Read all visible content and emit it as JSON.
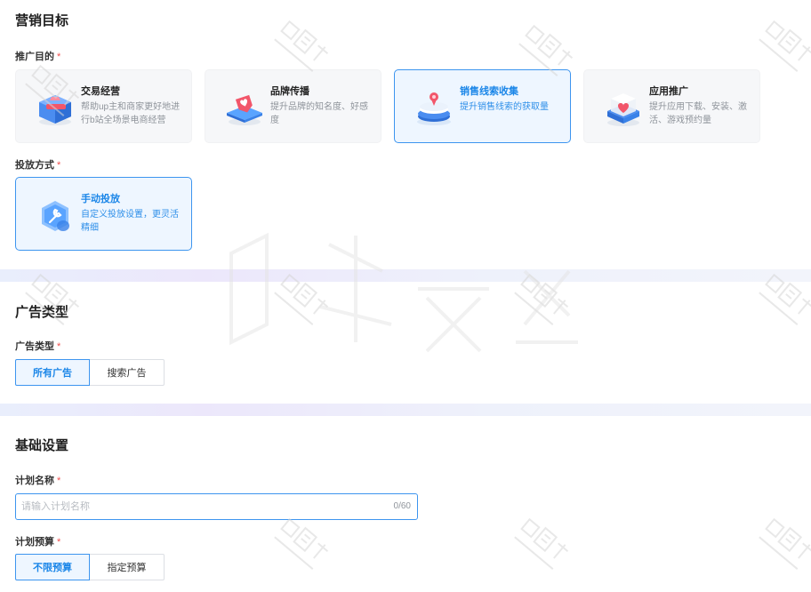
{
  "marketing": {
    "title": "营销目标",
    "purpose_label": "推广目的",
    "required_mark": "*",
    "cards": [
      {
        "title": "交易经营",
        "desc": "帮助up主和商家更好地进行b站全场景电商经营",
        "icon": "shopping-box-icon",
        "selected": false
      },
      {
        "title": "品牌传播",
        "desc": "提升品牌的知名度、好感度",
        "icon": "heart-tag-icon",
        "selected": false
      },
      {
        "title": "销售线索收集",
        "desc": "提升销售线索的获取量",
        "icon": "location-pin-stack-icon",
        "selected": true
      },
      {
        "title": "应用推广",
        "desc": "提升应用下载、安装、激活、游戏预约量",
        "icon": "app-cube-icon",
        "selected": false
      }
    ],
    "method_label": "投放方式",
    "method_card": {
      "title": "手动投放",
      "desc": "自定义投放设置，更灵活精细",
      "icon": "wrench-hexagon-icon",
      "selected": true
    }
  },
  "ad_type": {
    "title": "广告类型",
    "field_label": "广告类型",
    "options": [
      {
        "label": "所有广告",
        "selected": true
      },
      {
        "label": "搜索广告",
        "selected": false
      }
    ]
  },
  "basic": {
    "title": "基础设置",
    "plan_name_label": "计划名称",
    "plan_name_placeholder": "请输入计划名称",
    "plan_name_value": "",
    "plan_name_count": "0/60",
    "budget_label": "计划预算",
    "budget_options": [
      {
        "label": "不限预算",
        "selected": true
      },
      {
        "label": "指定预算",
        "selected": false
      }
    ]
  },
  "colors": {
    "accent": "#3d95ef",
    "accent_text": "#1b86e8",
    "required": "#f0504f"
  }
}
